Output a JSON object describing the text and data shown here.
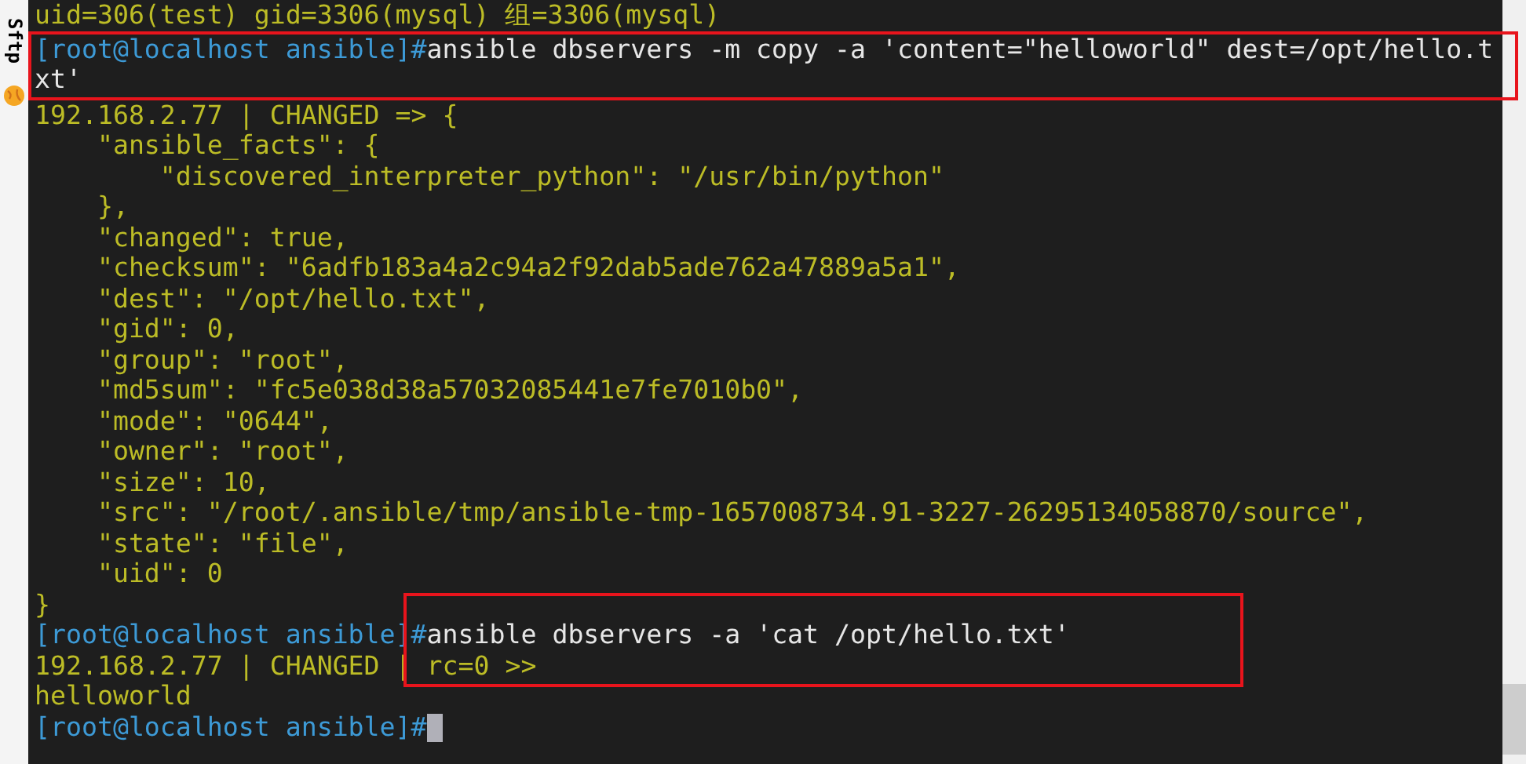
{
  "sidebar": {
    "label": "Sftp"
  },
  "terminal": {
    "blocks": [
      {
        "kind": "plain",
        "lines": [
          {
            "segments": [
              {
                "kind": "output",
                "text": "uid=306(test) gid=3306(mysql) 组=3306(mysql)"
              }
            ]
          }
        ]
      },
      {
        "kind": "boxed",
        "lines": [
          {
            "segments": [
              {
                "kind": "prompt",
                "text": "[root@localhost ansible]#"
              },
              {
                "kind": "command",
                "text": "ansible dbservers -m copy -a 'content=\"helloworld\" dest=/opt/hello.t"
              }
            ]
          },
          {
            "segments": [
              {
                "kind": "command",
                "text": "xt'"
              }
            ]
          }
        ]
      },
      {
        "kind": "plain",
        "lines": [
          {
            "segments": [
              {
                "kind": "output",
                "text": "192.168.2.77 | CHANGED => {"
              }
            ]
          },
          {
            "segments": [
              {
                "kind": "output",
                "text": "    \"ansible_facts\": {"
              }
            ]
          },
          {
            "segments": [
              {
                "kind": "output",
                "text": "        \"discovered_interpreter_python\": \"/usr/bin/python\""
              }
            ]
          },
          {
            "segments": [
              {
                "kind": "output",
                "text": "    },"
              }
            ]
          },
          {
            "segments": [
              {
                "kind": "output",
                "text": "    \"changed\": true,"
              }
            ]
          },
          {
            "segments": [
              {
                "kind": "output",
                "text": "    \"checksum\": \"6adfb183a4a2c94a2f92dab5ade762a47889a5a1\","
              }
            ]
          },
          {
            "segments": [
              {
                "kind": "output",
                "text": "    \"dest\": \"/opt/hello.txt\","
              }
            ]
          },
          {
            "segments": [
              {
                "kind": "output",
                "text": "    \"gid\": 0,"
              }
            ]
          },
          {
            "segments": [
              {
                "kind": "output",
                "text": "    \"group\": \"root\","
              }
            ]
          },
          {
            "segments": [
              {
                "kind": "output",
                "text": "    \"md5sum\": \"fc5e038d38a57032085441e7fe7010b0\","
              }
            ]
          },
          {
            "segments": [
              {
                "kind": "output",
                "text": "    \"mode\": \"0644\","
              }
            ]
          },
          {
            "segments": [
              {
                "kind": "output",
                "text": "    \"owner\": \"root\","
              }
            ]
          },
          {
            "segments": [
              {
                "kind": "output",
                "text": "    \"size\": 10,"
              }
            ]
          },
          {
            "segments": [
              {
                "kind": "output",
                "text": "    \"src\": \"/root/.ansible/tmp/ansible-tmp-1657008734.91-3227-26295134058870/source\","
              }
            ]
          },
          {
            "segments": [
              {
                "kind": "output",
                "text": "    \"state\": \"file\","
              }
            ]
          },
          {
            "segments": [
              {
                "kind": "output",
                "text": "    \"uid\": 0"
              }
            ]
          },
          {
            "segments": [
              {
                "kind": "output",
                "text": "}"
              }
            ]
          }
        ]
      },
      {
        "kind": "boxed_tail",
        "lines": [
          {
            "lead": [
              {
                "kind": "prompt",
                "text": "[root@localhost ansible]"
              }
            ],
            "tail": [
              {
                "kind": "prompt",
                "text": "#"
              },
              {
                "kind": "command",
                "text": "ansible dbservers -a 'cat /opt/hello.txt'"
              }
            ]
          },
          {
            "lead": [
              {
                "kind": "output",
                "text": "192.168.2.77 | CHANGED |"
              }
            ],
            "tail": [
              {
                "kind": "output",
                "text": " rc=0 >>"
              }
            ]
          }
        ]
      },
      {
        "kind": "plain",
        "lines": [
          {
            "segments": [
              {
                "kind": "output",
                "text": "helloworld"
              }
            ]
          },
          {
            "segments": [
              {
                "kind": "prompt",
                "text": "[root@localhost ansible]#"
              }
            ],
            "cursor": true
          }
        ]
      }
    ]
  }
}
